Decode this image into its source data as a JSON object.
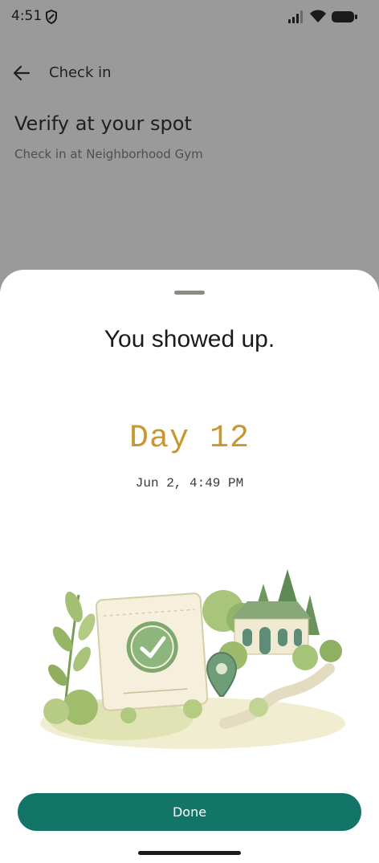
{
  "status_bar": {
    "time": "4:51",
    "icons": [
      "shield-icon",
      "signal-icon",
      "wifi-icon",
      "battery-icon"
    ]
  },
  "header": {
    "back_icon": "arrow-left-icon",
    "title": "Check in"
  },
  "page": {
    "heading": "Verify at your spot",
    "subheading": "Check in at Neighborhood Gym"
  },
  "sheet": {
    "title": "You showed up.",
    "day": "Day 12",
    "date": "Jun 2, 4:49 PM",
    "illustration": "ticket-checkmark-location-house-illustration",
    "done_label": "Done"
  },
  "colors": {
    "accent": "#137568",
    "day_gold": "#c9962f",
    "scrim": "#9a9a9a"
  }
}
